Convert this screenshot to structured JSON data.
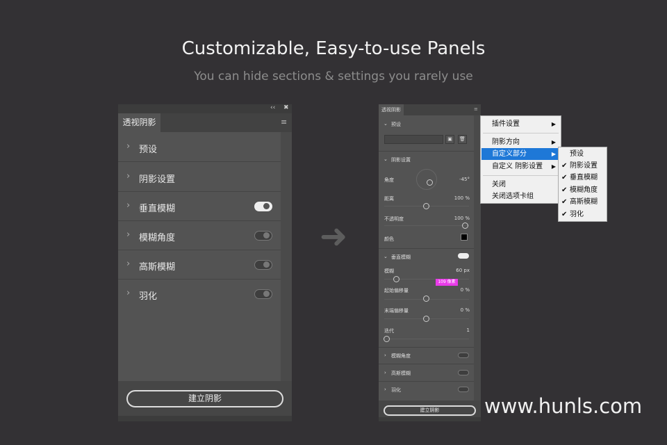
{
  "heading": {
    "title": "Customizable, Easy-to-use Panels",
    "subtitle": "You can hide sections & settings you rarely use"
  },
  "left_panel": {
    "collapse": "‹‹",
    "close": "✖",
    "tab": "透视阴影",
    "menu_icon": "hamburger-icon",
    "rows": [
      {
        "label": "预设",
        "toggle": null
      },
      {
        "label": "阴影设置",
        "toggle": null
      },
      {
        "label": "垂直模糊",
        "toggle": true
      },
      {
        "label": "模糊角度",
        "toggle": false
      },
      {
        "label": "高斯模糊",
        "toggle": false
      },
      {
        "label": "羽化",
        "toggle": false
      }
    ],
    "button": "建立阴影"
  },
  "right_panel": {
    "tab": "透视阴影",
    "preset": {
      "label": "预设",
      "input": ""
    },
    "shadow": {
      "label": "阴影设置",
      "angle_label": "角度",
      "angle": "-45°",
      "distance_label": "距离",
      "distance": "100 %",
      "distance_pct": 50,
      "opacity_label": "不透明度",
      "opacity": "100 %",
      "opacity_pct": 100,
      "color_label": "颜色",
      "color": "#000000"
    },
    "vblur": {
      "label": "垂直模糊",
      "on": true,
      "blur_label": "模糊",
      "blur": "60 px",
      "tooltip": "109 像素",
      "start_label": "起始偏移量",
      "start": "0 %",
      "end_label": "末端偏移量",
      "end": "0 %",
      "iter_label": "迭代",
      "iter": "1"
    },
    "collapsed": [
      {
        "label": "模糊角度"
      },
      {
        "label": "高斯模糊"
      },
      {
        "label": "羽化"
      }
    ],
    "button": "建立阴影"
  },
  "menu": {
    "items": [
      "插件设置",
      "阴影方向",
      "自定义部分",
      "自定义 阴影设置",
      "关闭",
      "关闭选项卡组"
    ],
    "selected": "自定义部分"
  },
  "submenu": {
    "items": [
      {
        "label": "预设",
        "checked": false
      },
      {
        "label": "阴影设置",
        "checked": true
      },
      {
        "label": "垂直模糊",
        "checked": true
      },
      {
        "label": "模糊角度",
        "checked": true
      },
      {
        "label": "高斯模糊",
        "checked": true
      },
      {
        "label": "羽化",
        "checked": true
      }
    ],
    "check": "✔"
  },
  "watermark": "www.hunls.com",
  "colors": {
    "accent": "#1e78d7",
    "tooltip": "#e93be9"
  }
}
